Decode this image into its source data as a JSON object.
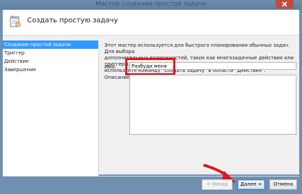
{
  "window": {
    "title": "Мастер создания простой задачи",
    "close_icon": "close-icon"
  },
  "header": {
    "title": "Создать простую задачу",
    "icon": "task-scheduler-icon"
  },
  "steps": [
    {
      "label": "Создание простой задачи",
      "active": true
    },
    {
      "label": "Триггер",
      "active": false
    },
    {
      "label": "Действие",
      "active": false
    },
    {
      "label": "Завершение",
      "active": false
    }
  ],
  "description": {
    "line1": "Этот мастер используется для быстрого планирования обычных задач.  Для выбора",
    "line2": "дополнительных возможностей, таких как многозадачные действия или триггеры,",
    "line3": "используйте команду \"Создать задачу\" в области \"Действия\"."
  },
  "form": {
    "name_label": "Имя:",
    "name_value": "Разбуди меня",
    "description_label": "Описание:",
    "description_value": ""
  },
  "buttons": {
    "back": "< Назад",
    "next": "Далее >",
    "cancel": "Отмена"
  },
  "colors": {
    "highlight": "#e1131b",
    "arrow": "#e1131b",
    "selected_step": "#3399ff",
    "titlebar": "#6f8fb1"
  }
}
